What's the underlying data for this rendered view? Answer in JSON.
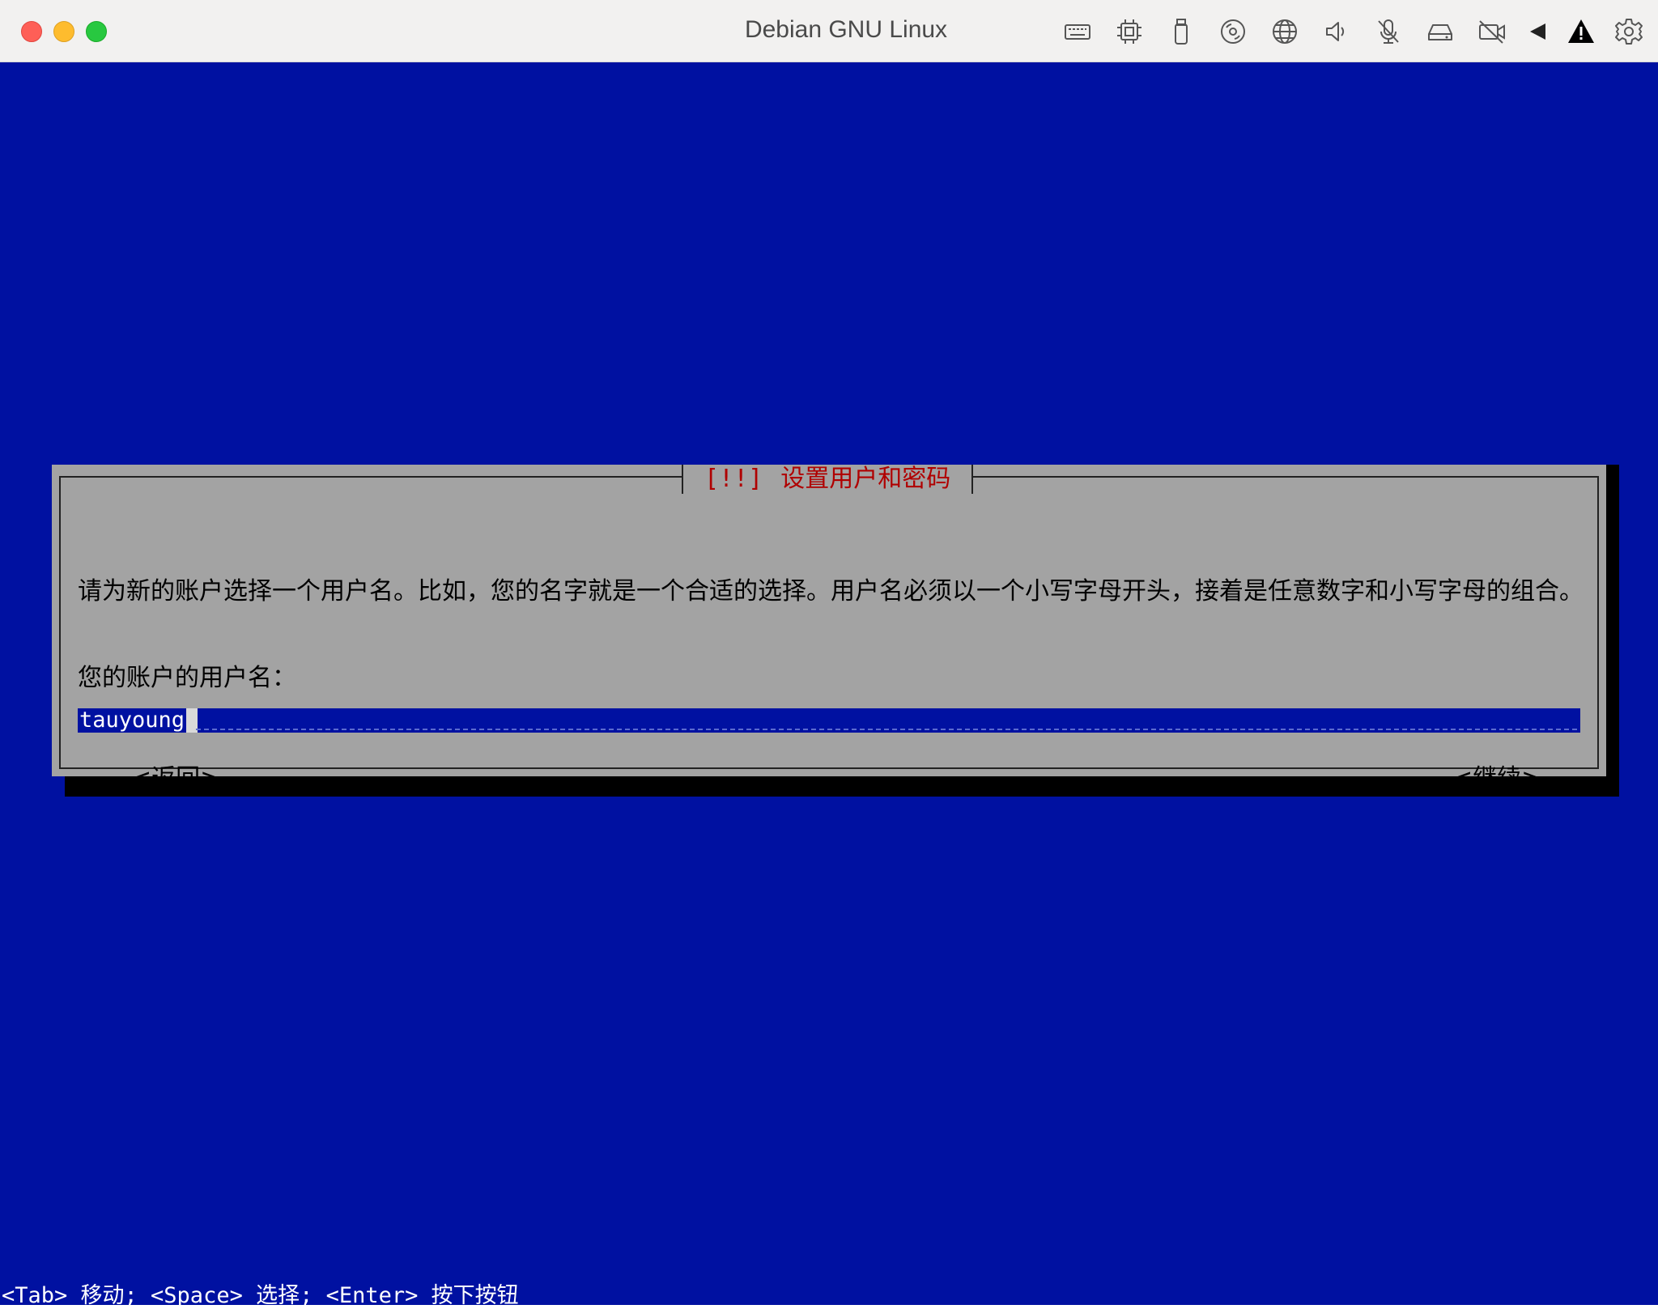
{
  "window": {
    "title": "Debian GNU Linux"
  },
  "toolbar": {
    "icons": [
      "keyboard-icon",
      "cpu-icon",
      "usb-icon",
      "optical-disc-icon",
      "network-icon",
      "speaker-icon",
      "microphone-muted-icon",
      "hard-drive-icon",
      "camera-off-icon",
      "play-back-icon",
      "warning-icon",
      "gear-icon"
    ]
  },
  "dialog": {
    "mark": "[!!]",
    "title": "设置用户和密码",
    "description": "请为新的账户选择一个用户名。比如，您的名字就是一个合适的选择。用户名必须以一个小写字母开头，接着是任意数字和小写字母的组合。",
    "field_label": "您的账户的用户名：",
    "username_value": "tauyoung",
    "back_label": "<返回>",
    "continue_label": "<继续>"
  },
  "footer": {
    "hint": "<Tab> 移动; <Space> 选择; <Enter> 按下按钮"
  },
  "colors": {
    "screen_bg": "#0011a1",
    "dialog_bg": "#a3a3a3",
    "title_fg": "#b00000"
  }
}
